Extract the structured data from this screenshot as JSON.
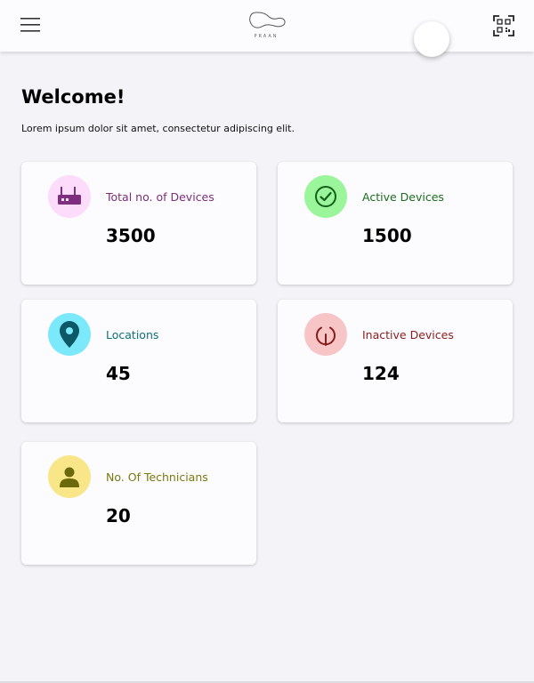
{
  "header": {
    "logo_text": "PRAAN",
    "icons": {
      "menu": "hamburger-menu-icon",
      "logo": "praan-logo-icon",
      "scan": "qr-scan-icon"
    }
  },
  "welcome": {
    "title": "Welcome!",
    "subtitle": "Lorem ipsum dolor sit amet, consectetur adipiscing elit."
  },
  "cards": [
    {
      "label": "Total no. of Devices",
      "value": "3500",
      "icon": "router-icon",
      "icon_bg": "#fcdcfa",
      "icon_color": "#7e2f7e",
      "label_color": "#7a2f78"
    },
    {
      "label": "Active Devices",
      "value": "1500",
      "icon": "check-circle-icon",
      "icon_bg": "#9af59b",
      "icon_color": "#146018",
      "label_color": "#1a6d1e"
    },
    {
      "label": "Locations",
      "value": "45",
      "icon": "location-pin-icon",
      "icon_bg": "#7ce9fb",
      "icon_color": "#0c5866",
      "label_color": "#10707a"
    },
    {
      "label": "Inactive Devices",
      "value": "124",
      "icon": "power-off-icon",
      "icon_bg": "#f8c5c6",
      "icon_color": "#8a1b1b",
      "label_color": "#8c1c1c"
    },
    {
      "label": "No. Of Technicians",
      "value": "20",
      "icon": "person-icon",
      "icon_bg": "#f8e688",
      "icon_color": "#6a6a0c",
      "label_color": "#7a7a0f"
    }
  ]
}
